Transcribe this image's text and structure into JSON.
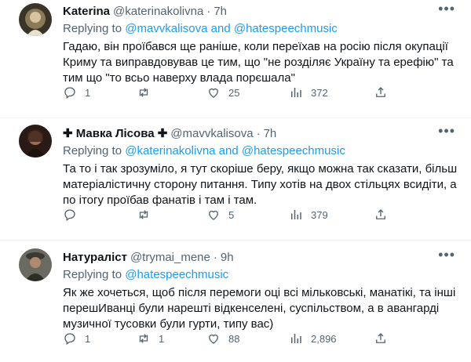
{
  "tweets": [
    {
      "name": "Katerina",
      "handle": "@katerinakolivna",
      "time": "7h",
      "replying_prefix": "Replying to ",
      "replying_mention": "@mavvkalisova and @hatespeechmusic",
      "text": "Гадаю, він проїбався ще раніше, коли переїхав на росію після окупації\nКриму та виправдовував це тим, що \"не розділяє  Україну та ерефію\" та\nтим що \"то всьо наверху влада порєшала\"",
      "replies": "1",
      "retweets": "",
      "likes": "25",
      "views": "372"
    },
    {
      "name": "✚ Мавка Лісова ✚",
      "handle": "@mavvkalisova",
      "time": "7h",
      "replying_prefix": "Replying to ",
      "replying_mention": "@katerinakolivna and @hatespeechmusic",
      "text": "Та то і так зрозуміло, я тут скоріше беру, якщо можна так сказати, більш\nматеріалістичну сторону питання. Типу хотів на двох стільцях всидіти, а\nпо ітогу проїбав фанатів і там і там.",
      "replies": "",
      "retweets": "",
      "likes": "5",
      "views": "379"
    },
    {
      "name": "Натураліст",
      "handle": "@trymai_mene",
      "time": "9h",
      "replying_prefix": "Replying to ",
      "replying_mention": "@hatespeechmusic",
      "text": "Як же хочеться, щоб після перемоги оці всі мільковські, манатікі, та інші\nперешИванці були нарешті відкенселені, суспільством, а в авангарді\nмузичної тусовки були гурти, типу вас)",
      "replies": "1",
      "retweets": "1",
      "likes": "88",
      "views": "2,896"
    }
  ],
  "icons": [
    "reply-icon",
    "retweet-icon",
    "like-icon",
    "views-icon",
    "share-icon",
    "more-icon"
  ],
  "colors": {
    "mention": "#1d9bf0",
    "muted": "#536471",
    "text": "#0f1419"
  }
}
